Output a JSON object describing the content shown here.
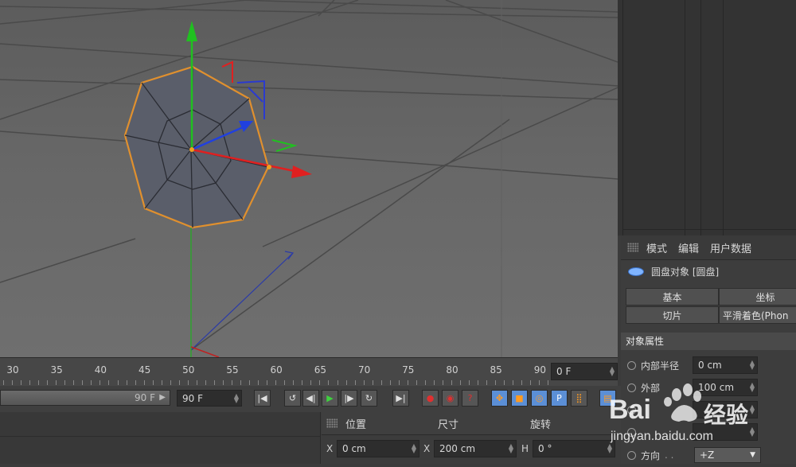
{
  "timeline": {
    "ticks": [
      "30",
      "35",
      "40",
      "45",
      "50",
      "55",
      "60",
      "65",
      "70",
      "75",
      "80",
      "85",
      "90"
    ],
    "current_frame": "0 F"
  },
  "transport": {
    "end_slider_label": "90 F",
    "end_frame": "90 F"
  },
  "attributes": {
    "menu": [
      "模式",
      "编辑",
      "用户数据"
    ],
    "object_title": "圆盘对象 [圆盘]",
    "tabs": [
      "基本",
      "坐标",
      "切片",
      "平滑着色(Phon"
    ],
    "section": "对象属性",
    "props": {
      "inner_radius_label": "内部半径",
      "inner_radius_value": "0 cm",
      "outer_radius_label": "外部",
      "outer_radius_value": "100 cm",
      "direction_label": "方向",
      "direction_value": "+Z"
    }
  },
  "coordinates": {
    "headers": [
      "位置",
      "尺寸",
      "旋转"
    ],
    "x_label": "X",
    "position_x": "0 cm",
    "size_x": "200 cm",
    "h_label": "H",
    "rotation_h": "0 °"
  },
  "watermark": {
    "brand": "Bai",
    "brand_cn": "经验",
    "url": "jingyan.baidu.com"
  },
  "colors": {
    "selection_outline": "#e0902e",
    "axis_x": "#e02020",
    "axis_y": "#20c020",
    "axis_z": "#2040e0",
    "accent_blue": "#3f7fd6"
  }
}
